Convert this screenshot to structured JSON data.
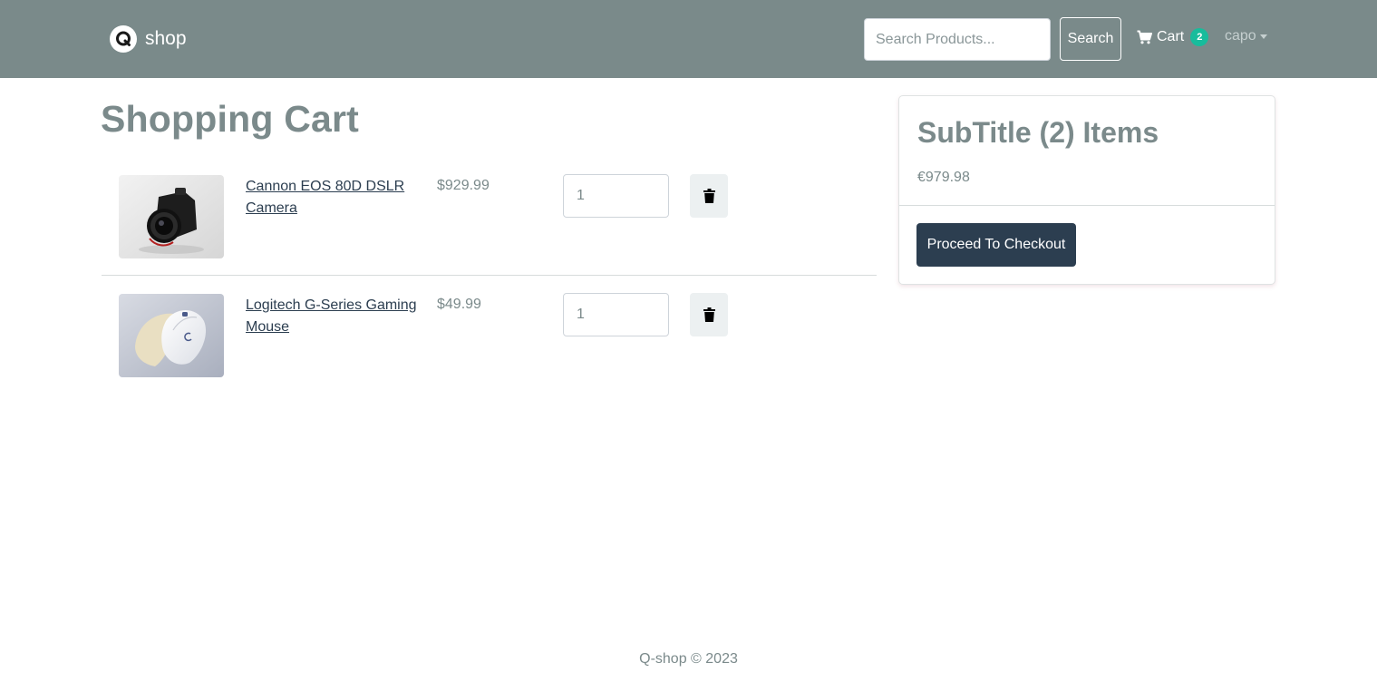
{
  "brand": {
    "name": "shop",
    "logo_letter": "Q"
  },
  "search": {
    "placeholder": "Search Products...",
    "value": "",
    "button_label": "Search"
  },
  "nav": {
    "cart_label": "Cart",
    "cart_count": "2",
    "user_name": "capo"
  },
  "page": {
    "title": "Shopping Cart"
  },
  "cart": {
    "items": [
      {
        "name": "Cannon EOS 80D DSLR Camera",
        "price": "$929.99",
        "quantity": "1",
        "image": "camera-photo"
      },
      {
        "name": "Logitech G-Series Gaming Mouse",
        "price": "$49.99",
        "quantity": "1",
        "image": "mouse-photo"
      }
    ]
  },
  "summary": {
    "title": "SubTitle (2) Items",
    "total": "€979.98",
    "checkout_label": "Proceed To Checkout"
  },
  "footer": {
    "text": "Q-shop © 2023"
  },
  "colors": {
    "navbar": "#7a8a8a",
    "primary": "#2c3e50",
    "badge": "#18bc9c",
    "text_muted": "#7b8a8b"
  }
}
